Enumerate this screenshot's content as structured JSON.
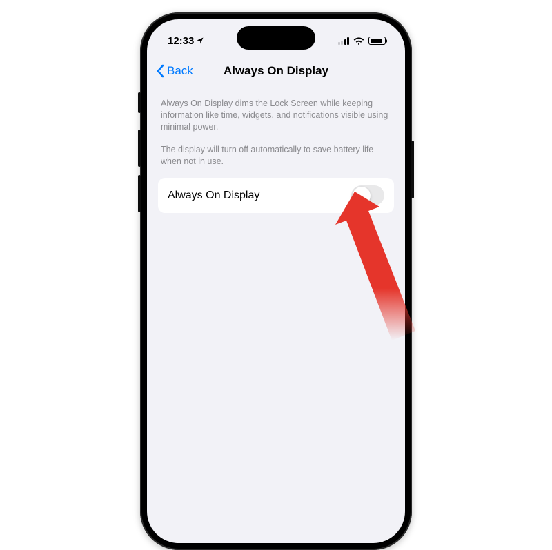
{
  "status": {
    "time": "12:33",
    "location_active": true
  },
  "nav": {
    "back_label": "Back",
    "title": "Always On Display"
  },
  "description": {
    "p1": "Always On Display dims the Lock Screen while keeping information like time, widgets, and notifications visible using minimal power.",
    "p2": "The display will turn off automatically to save battery life when not in use."
  },
  "setting": {
    "label": "Always On Display",
    "enabled": false
  }
}
